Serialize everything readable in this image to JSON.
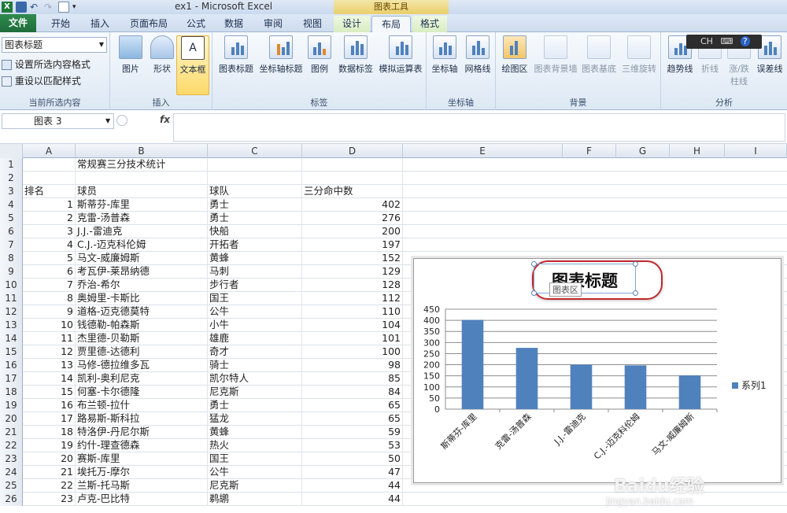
{
  "window": {
    "title": "ex1 - Microsoft Excel",
    "chart_tools": "图表工具"
  },
  "tabs": [
    {
      "label": "文件"
    },
    {
      "label": "开始"
    },
    {
      "label": "插入"
    },
    {
      "label": "页面布局"
    },
    {
      "label": "公式"
    },
    {
      "label": "数据"
    },
    {
      "label": "审阅"
    },
    {
      "label": "视图"
    },
    {
      "label": "设计"
    },
    {
      "label": "布局"
    },
    {
      "label": "格式"
    }
  ],
  "ribbon": {
    "current_selection": {
      "dropdown_value": "图表标题",
      "format_selection": "设置所选内容格式",
      "reset_style": "重设以匹配样式",
      "label": "当前所选内容"
    },
    "insert": {
      "label": "插入",
      "picture": "图片",
      "shapes": "形状",
      "textbox": "文本框"
    },
    "labels": {
      "label": "标签",
      "chart_title": "图表标题",
      "axis_titles": "坐标轴标题",
      "legend": "图例",
      "data_labels": "数据标签",
      "data_table": "模拟运算表"
    },
    "axes": {
      "label": "坐标轴",
      "axes": "坐标轴",
      "gridlines": "网格线"
    },
    "background": {
      "label": "背景",
      "plot_area": "绘图区",
      "chart_wall": "图表背景墙",
      "chart_floor": "图表基底",
      "rotation": "三维旋转"
    },
    "analysis": {
      "label": "分析",
      "trendline": "趋势线",
      "lines": "折线",
      "updown_1": "涨/跌",
      "updown_2": "柱线",
      "error_bars": "误差线"
    }
  },
  "ime": {
    "text": "CH"
  },
  "formula_bar": {
    "name_box": "图表 3",
    "fx": "fx",
    "formula": ""
  },
  "columns": [
    "A",
    "B",
    "C",
    "D",
    "E",
    "F",
    "G",
    "H",
    "I"
  ],
  "sheet": {
    "rows": [
      {
        "n": "1",
        "a": "",
        "b": "常规赛三分技术统计",
        "c": "",
        "d": ""
      },
      {
        "n": "2",
        "a": "",
        "b": "",
        "c": "",
        "d": ""
      },
      {
        "n": "3",
        "a": "排名",
        "b": "球员",
        "c": "球队",
        "d": "三分命中数"
      },
      {
        "n": "4",
        "a": "1",
        "b": "斯蒂芬-库里",
        "c": "勇士",
        "d": "402"
      },
      {
        "n": "5",
        "a": "2",
        "b": "克雷-汤普森",
        "c": "勇士",
        "d": "276"
      },
      {
        "n": "6",
        "a": "3",
        "b": "J.J.-雷迪克",
        "c": "快船",
        "d": "200"
      },
      {
        "n": "7",
        "a": "4",
        "b": "C.J.-迈克科伦姆",
        "c": "开拓者",
        "d": "197"
      },
      {
        "n": "8",
        "a": "5",
        "b": "马文-威廉姆斯",
        "c": "黄蜂",
        "d": "152"
      },
      {
        "n": "9",
        "a": "6",
        "b": "考瓦伊-莱昂纳德",
        "c": "马刺",
        "d": "129"
      },
      {
        "n": "10",
        "a": "7",
        "b": "乔治-希尔",
        "c": "步行者",
        "d": "128"
      },
      {
        "n": "11",
        "a": "8",
        "b": "奥姆里-卡斯比",
        "c": "国王",
        "d": "112"
      },
      {
        "n": "12",
        "a": "9",
        "b": "道格-迈克德莫特",
        "c": "公牛",
        "d": "110"
      },
      {
        "n": "13",
        "a": "10",
        "b": "钱德勒-帕森斯",
        "c": "小牛",
        "d": "104"
      },
      {
        "n": "14",
        "a": "11",
        "b": "杰里德-贝勒斯",
        "c": "雄鹿",
        "d": "101"
      },
      {
        "n": "15",
        "a": "12",
        "b": "贾里德-达德利",
        "c": "奇才",
        "d": "100"
      },
      {
        "n": "16",
        "a": "13",
        "b": "马修-德拉维多瓦",
        "c": "骑士",
        "d": "98"
      },
      {
        "n": "17",
        "a": "14",
        "b": "凯利-奥利尼克",
        "c": "凯尔特人",
        "d": "85"
      },
      {
        "n": "18",
        "a": "15",
        "b": "何塞-卡尔德隆",
        "c": "尼克斯",
        "d": "84"
      },
      {
        "n": "19",
        "a": "16",
        "b": "布兰顿-拉什",
        "c": "勇士",
        "d": "65"
      },
      {
        "n": "20",
        "a": "17",
        "b": "路易斯-斯科拉",
        "c": "猛龙",
        "d": "65"
      },
      {
        "n": "21",
        "a": "18",
        "b": "特洛伊-丹尼尔斯",
        "c": "黄蜂",
        "d": "59"
      },
      {
        "n": "22",
        "a": "19",
        "b": "约什-理查德森",
        "c": "热火",
        "d": "53"
      },
      {
        "n": "23",
        "a": "20",
        "b": "赛斯-库里",
        "c": "国王",
        "d": "50"
      },
      {
        "n": "24",
        "a": "21",
        "b": "埃托万-摩尔",
        "c": "公牛",
        "d": "47"
      },
      {
        "n": "25",
        "a": "22",
        "b": "兰斯-托马斯",
        "c": "尼克斯",
        "d": "44"
      },
      {
        "n": "26",
        "a": "23",
        "b": "卢克-巴比特",
        "c": "鹈鹕",
        "d": "44"
      }
    ]
  },
  "chart": {
    "tooltip": "图表区",
    "colors": {
      "bar": "#4f81bd",
      "callout": "#c0282d"
    }
  },
  "chart_data": {
    "type": "bar",
    "title": "图表标题",
    "categories": [
      "斯蒂芬-库里",
      "克雷-汤普森",
      "J.J.-雷迪克",
      "C.J.-迈克科伦姆",
      "马文-威廉姆斯"
    ],
    "series": [
      {
        "name": "系列1",
        "values": [
          402,
          276,
          200,
          197,
          152
        ]
      }
    ],
    "ylim": [
      0,
      450
    ],
    "yticks": [
      0,
      50,
      100,
      150,
      200,
      250,
      300,
      350,
      400,
      450
    ],
    "grid": true,
    "legend": "right"
  },
  "watermark": {
    "text": "Baidu经验",
    "url": "jingyan.baidu.com"
  }
}
